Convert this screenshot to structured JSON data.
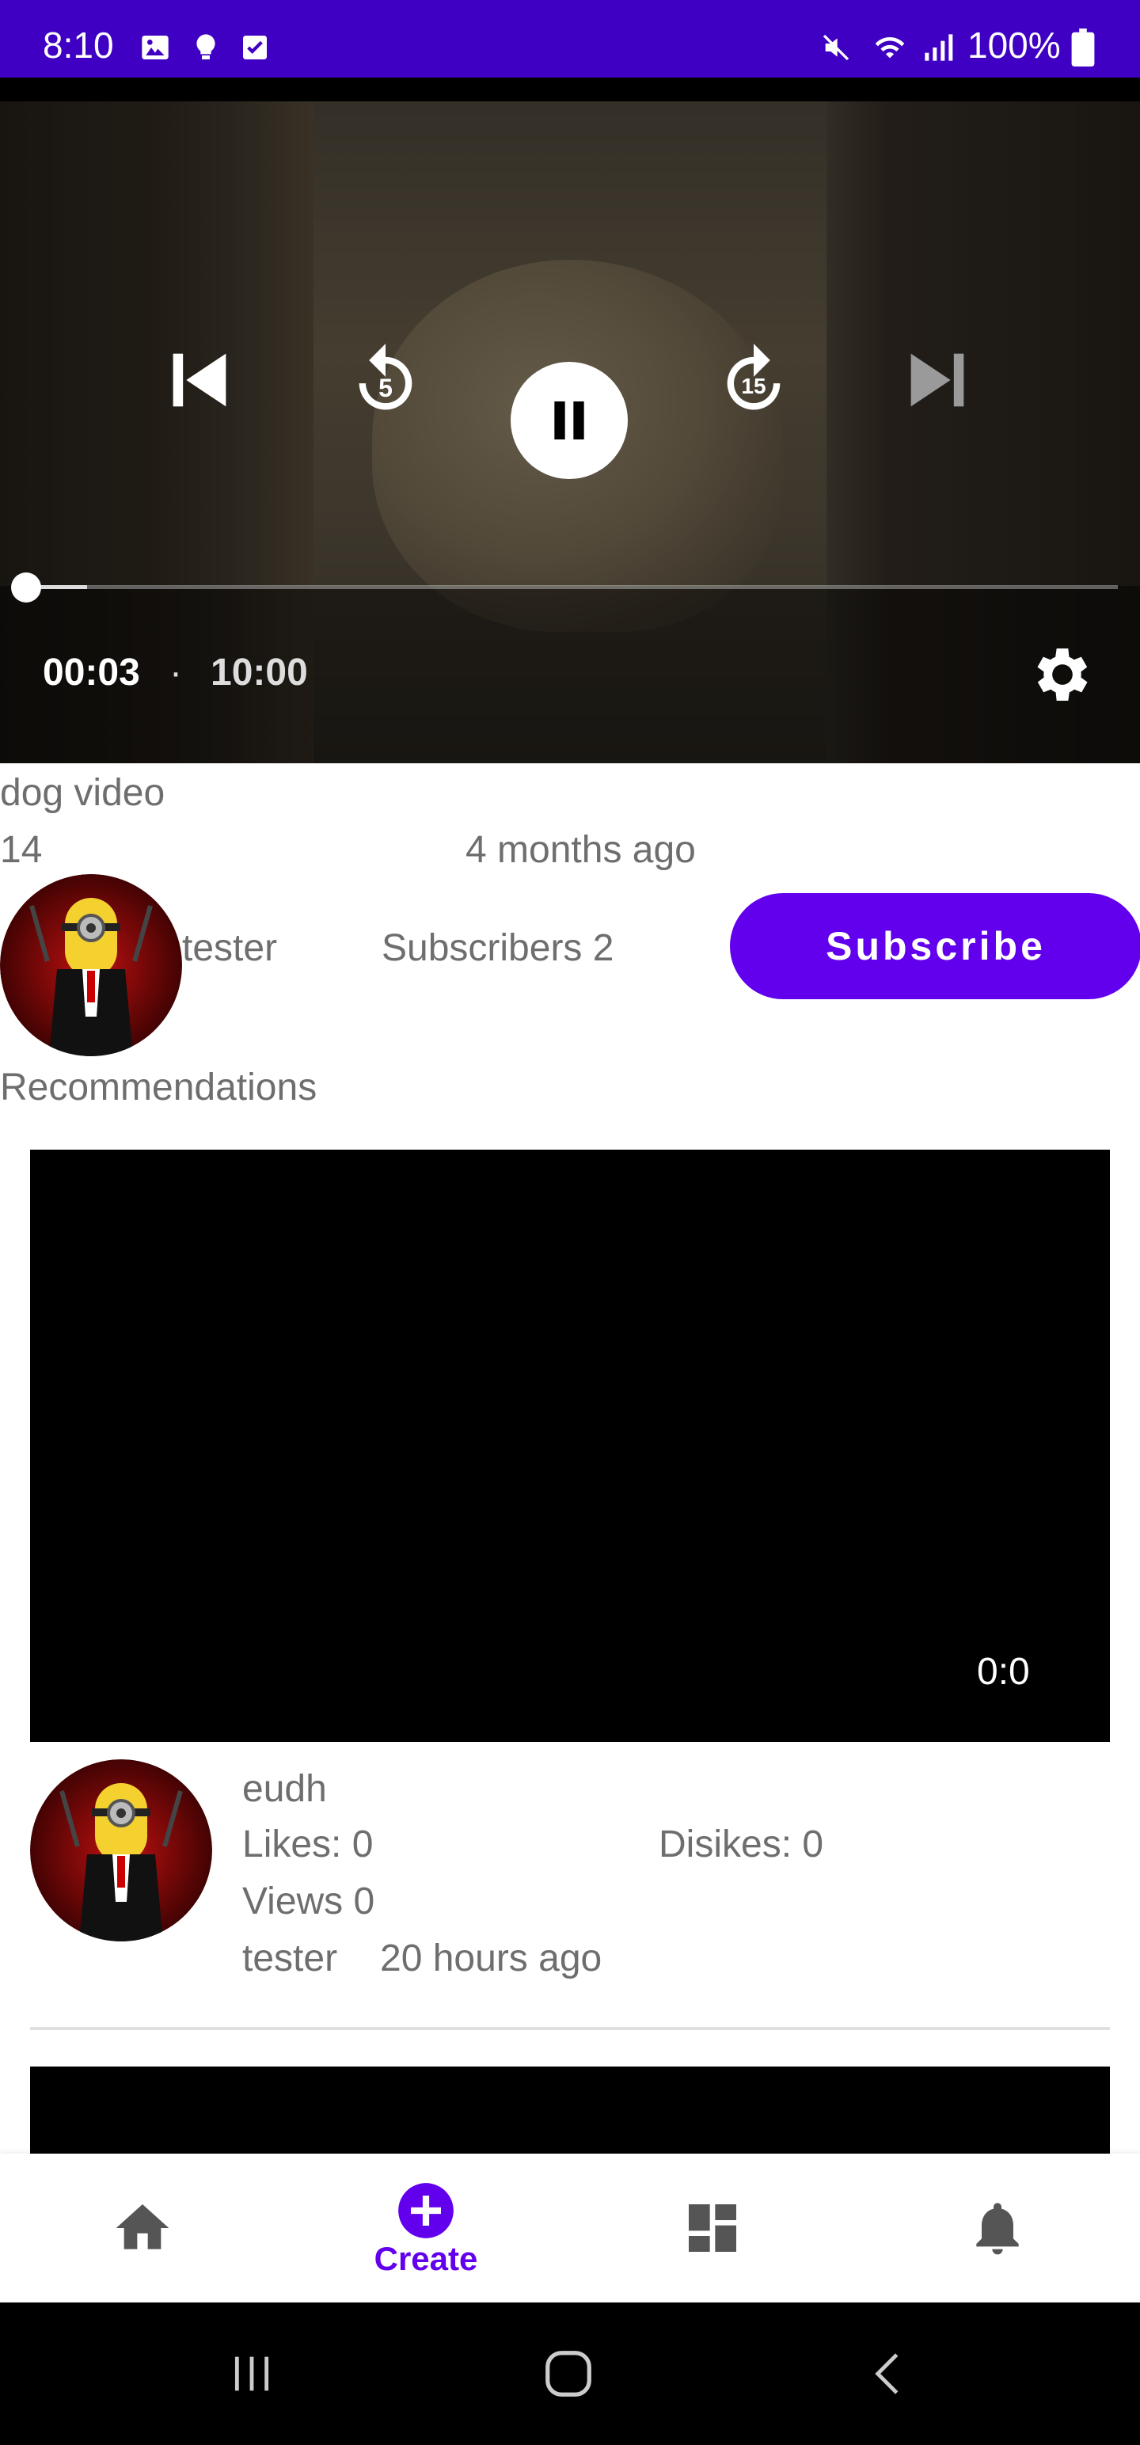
{
  "status_bar": {
    "time": "8:10",
    "battery": "100%",
    "background": "#3f00c4"
  },
  "player": {
    "current_time": "00:03",
    "separator": "·",
    "total_time": "10:00",
    "progress_fraction": 0.005,
    "rewind_seconds": "5",
    "forward_seconds": "15",
    "icons": [
      "skip-previous-icon",
      "replay-5-icon",
      "pause-icon",
      "forward-15-icon",
      "skip-next-icon",
      "settings-icon"
    ]
  },
  "video": {
    "title": "dog video",
    "views": "14",
    "age": "4 months ago",
    "channel_name": "tester",
    "subscribers": "Subscribers 2",
    "subscribe_label": "Subscribe"
  },
  "recommendations": {
    "heading": "Recommendations",
    "items": [
      {
        "duration": "0:0",
        "title": "eudh",
        "likes": "Likes: 0",
        "dislikes": "Disikes: 0",
        "views": "Views 0",
        "author": "tester",
        "time": "20 hours ago"
      }
    ]
  },
  "bottom_nav": {
    "items": [
      {
        "icon": "home-icon",
        "label": ""
      },
      {
        "icon": "add-circle-icon",
        "label": "Create"
      },
      {
        "icon": "dashboard-icon",
        "label": ""
      },
      {
        "icon": "bell-icon",
        "label": ""
      }
    ],
    "accent": "#6200ee",
    "icon_color": "#555555"
  },
  "colors": {
    "accent": "#6200ee",
    "text_secondary": "#6e6e6e"
  }
}
